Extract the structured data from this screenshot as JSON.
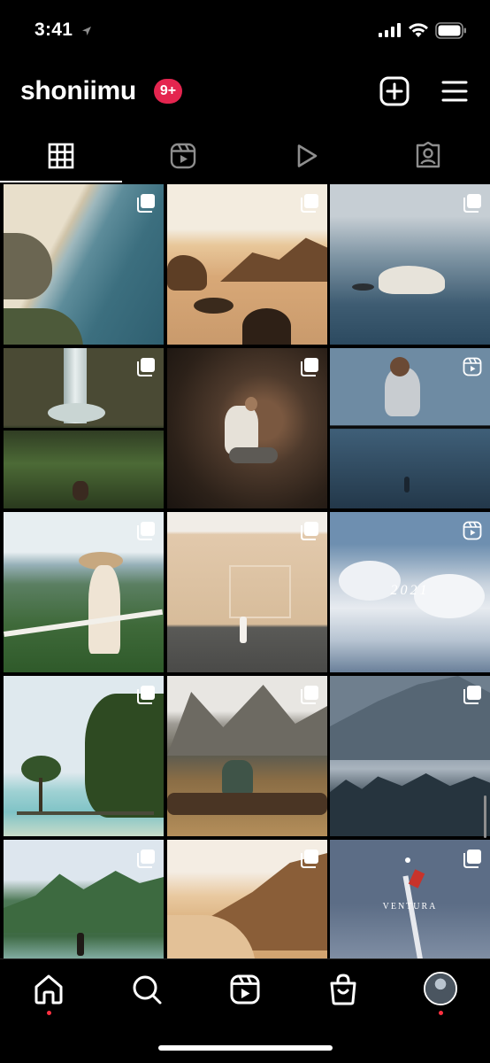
{
  "status_bar": {
    "time": "3:41"
  },
  "header": {
    "username": "shoniimu",
    "notification_badge": "9+",
    "badge_color": "#e4254f"
  },
  "tabs": [
    {
      "name": "posts-grid",
      "icon": "grid-icon",
      "selected": true
    },
    {
      "name": "reels",
      "icon": "reels-icon",
      "selected": false
    },
    {
      "name": "videos",
      "icon": "play-icon",
      "selected": false
    },
    {
      "name": "tagged",
      "icon": "tagged-person-icon",
      "selected": false
    }
  ],
  "posts": [
    {
      "badge": "carousel-icon"
    },
    {
      "badge": "carousel-icon"
    },
    {
      "badge": "carousel-icon"
    },
    {
      "badge": "carousel-icon"
    },
    {
      "badge": "carousel-icon"
    },
    {
      "badge": "reels-icon"
    },
    {
      "badge": "carousel-icon"
    },
    {
      "badge": "carousel-icon"
    },
    {
      "badge": "reels-icon",
      "caption": "2021"
    },
    {
      "badge": "carousel-icon"
    },
    {
      "badge": "carousel-icon"
    },
    {
      "badge": "carousel-icon"
    },
    {
      "badge": "carousel-icon"
    },
    {
      "badge": "carousel-icon"
    },
    {
      "badge": "carousel-icon",
      "caption": "VENTURA"
    }
  ],
  "bottom_nav": [
    {
      "icon": "home-icon",
      "active": true
    },
    {
      "icon": "search-icon"
    },
    {
      "icon": "reels-icon"
    },
    {
      "icon": "shop-icon"
    },
    {
      "icon": "profile-avatar"
    }
  ],
  "colors": {
    "background": "#000000",
    "notification_dot": "#ff3040"
  }
}
